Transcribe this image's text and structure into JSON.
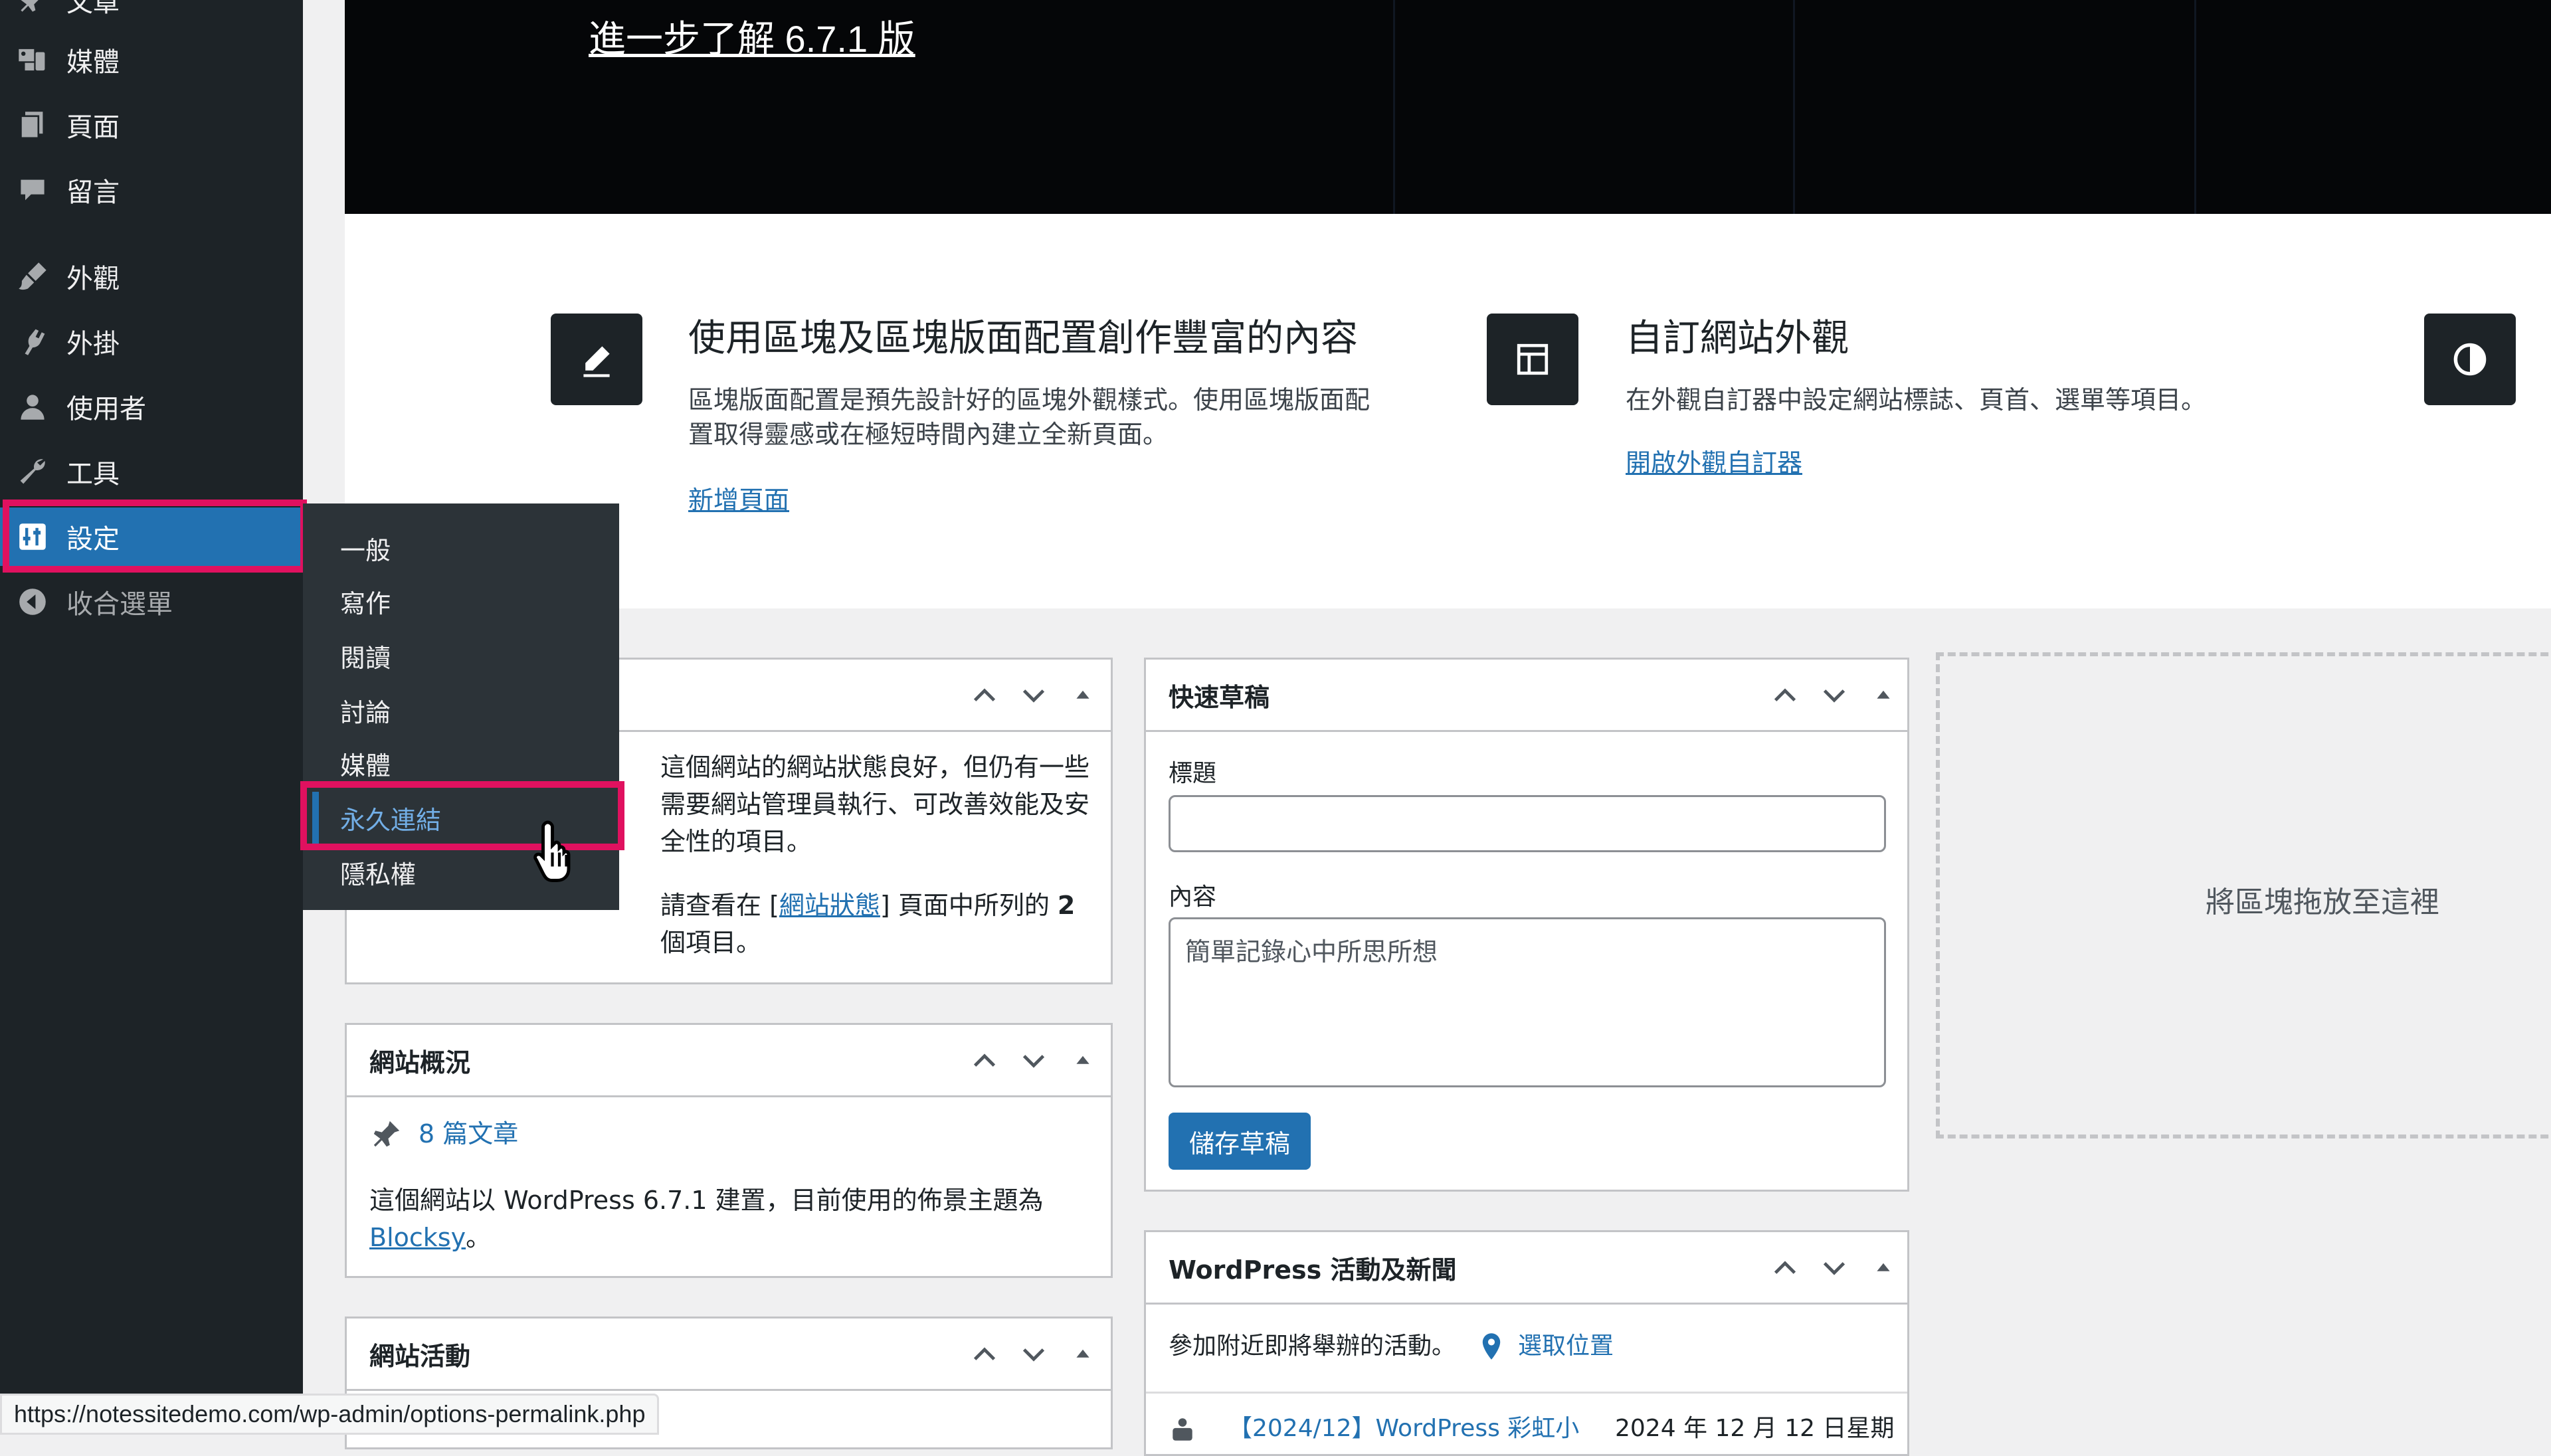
{
  "sidebar": {
    "items": [
      {
        "label": "文章",
        "icon": "pin-icon"
      },
      {
        "label": "媒體",
        "icon": "media-icon"
      },
      {
        "label": "頁面",
        "icon": "page-icon"
      },
      {
        "label": "留言",
        "icon": "comment-icon"
      },
      {
        "label": "外觀",
        "icon": "brush-icon"
      },
      {
        "label": "外掛",
        "icon": "plugin-icon"
      },
      {
        "label": "使用者",
        "icon": "user-icon"
      },
      {
        "label": "工具",
        "icon": "wrench-icon"
      },
      {
        "label": "設定",
        "icon": "settings-icon"
      },
      {
        "label": "收合選單",
        "icon": "collapse-icon"
      }
    ],
    "active_color": "#2271b1",
    "highlight_color": "#e0115f"
  },
  "submenu": {
    "items": [
      "一般",
      "寫作",
      "閱讀",
      "討論",
      "媒體",
      "永久連結",
      "隱私權"
    ],
    "current": "永久連結"
  },
  "banner": {
    "link": "進一步了解 6.7.1 版"
  },
  "features": [
    {
      "icon": "pencil-icon",
      "title": "使用區塊及區塊版面配置創作豐富的內容",
      "desc_line1": "區塊版面配置是預先設計好的區塊外觀樣式。使用區塊版面配",
      "desc_line2": "置取得靈感或在極短時間內建立全新頁面。",
      "link": "新增頁面"
    },
    {
      "icon": "layout-icon",
      "title": "自訂網站外觀",
      "desc_line1": "在外觀自訂器中設定網站標誌、頁首、選單等項目。",
      "link": "開啟外觀自訂器"
    },
    {
      "icon": "contrast-icon"
    }
  ],
  "site_health": {
    "text_line1": "這個網站的網站狀態良好，但仍有一些",
    "text_line2": "需要網站管理員執行、可改善效能及安",
    "text_line3": "全性的項目。",
    "note_prefix": "請查看在 [",
    "note_link": "網站狀態",
    "note_mid": "] 頁面中所列的 ",
    "note_count": "2",
    "note_suffix": "個項目。"
  },
  "at_a_glance": {
    "title": "網站概況",
    "posts": "8 篇文章",
    "text": "這個網站以 WordPress 6.7.1 建置，目前使用的佈景主題為",
    "theme": "Blocksy",
    "theme_suffix": "。"
  },
  "activity": {
    "title": "網站活動"
  },
  "quick_draft": {
    "title": "快速草稿",
    "title_label": "標題",
    "title_value": "",
    "content_label": "內容",
    "content_placeholder": "簡單記錄心中所思所想",
    "save_button": "儲存草稿"
  },
  "events": {
    "title": "WordPress 活動及新聞",
    "text": "參加附近即將舉辦的活動。",
    "location_link": "選取位置",
    "event_title": "【2024/12】WordPress 彩虹小",
    "event_date": "2024 年 12 月 12 日星期"
  },
  "dropzone": {
    "text": "將區塊拖放至這裡"
  },
  "status_url": "https://notessitedemo.com/wp-admin/options-permalink.php"
}
